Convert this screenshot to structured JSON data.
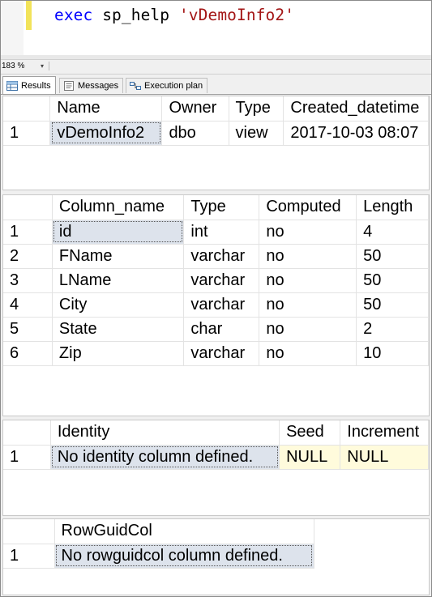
{
  "editor": {
    "keyword": "exec",
    "proc": "sp_help",
    "arg": "'vDemoInfo2'"
  },
  "zoom": {
    "value": "183 %"
  },
  "tabs": [
    {
      "label": "Results",
      "icon": "grid-icon"
    },
    {
      "label": "Messages",
      "icon": "message-icon"
    },
    {
      "label": "Execution plan",
      "icon": "execution-plan-icon"
    }
  ],
  "grid1": {
    "headers": [
      "Name",
      "Owner",
      "Type",
      "Created_datetime"
    ],
    "rows": [
      {
        "n": "1",
        "cells": [
          "vDemoInfo2",
          "dbo",
          "view",
          "2017-10-03 08:07"
        ]
      }
    ]
  },
  "grid2": {
    "headers": [
      "Column_name",
      "Type",
      "Computed",
      "Length"
    ],
    "rows": [
      {
        "n": "1",
        "cells": [
          "id",
          "int",
          "no",
          "4"
        ]
      },
      {
        "n": "2",
        "cells": [
          "FName",
          "varchar",
          "no",
          "50"
        ]
      },
      {
        "n": "3",
        "cells": [
          "LName",
          "varchar",
          "no",
          "50"
        ]
      },
      {
        "n": "4",
        "cells": [
          "City",
          "varchar",
          "no",
          "50"
        ]
      },
      {
        "n": "5",
        "cells": [
          "State",
          "char",
          "no",
          "2"
        ]
      },
      {
        "n": "6",
        "cells": [
          "Zip",
          "varchar",
          "no",
          "10"
        ]
      }
    ]
  },
  "grid3": {
    "headers": [
      "Identity",
      "Seed",
      "Increment"
    ],
    "rows": [
      {
        "n": "1",
        "cells": [
          "No identity column defined.",
          "NULL",
          "NULL"
        ]
      }
    ]
  },
  "grid4": {
    "headers": [
      "RowGuidCol"
    ],
    "rows": [
      {
        "n": "1",
        "cells": [
          "No rowguidcol column defined."
        ]
      }
    ]
  },
  "colors": {
    "keyword": "#0000ff",
    "string": "#a31515",
    "change_bar": "#f2e35a",
    "selected_cell": "#dde3ec",
    "null_cell": "#fffbdc"
  }
}
